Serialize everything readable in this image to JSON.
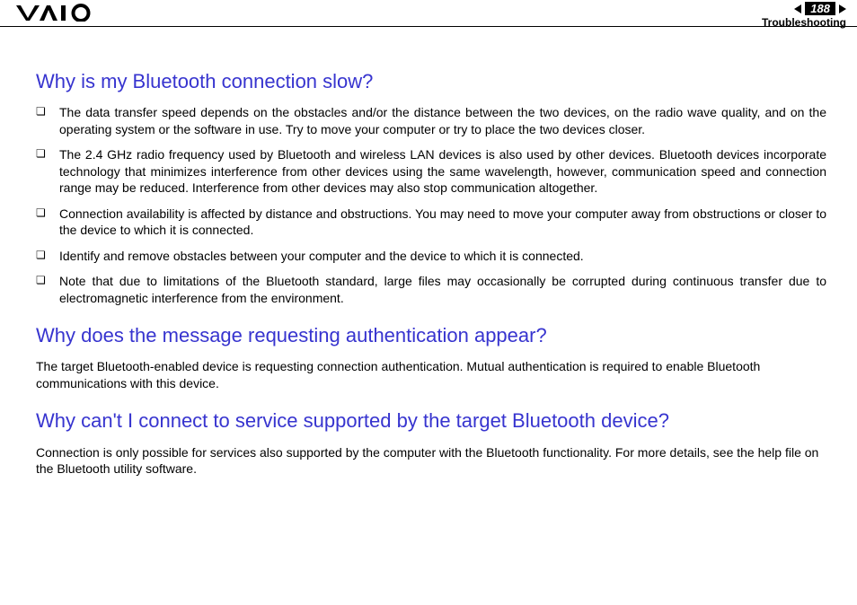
{
  "header": {
    "page_number": "188",
    "section": "Troubleshooting"
  },
  "sections": [
    {
      "heading": "Why is my Bluetooth connection slow?",
      "bullets": [
        "The data transfer speed depends on the obstacles and/or the distance between the two devices, on the radio wave quality, and on the operating system or the software in use. Try to move your computer or try to place the two devices closer.",
        "The 2.4 GHz radio frequency used by Bluetooth and wireless LAN devices is also used by other devices. Bluetooth devices incorporate technology that minimizes interference from other devices using the same wavelength, however, communication speed and connection range may be reduced. Interference from other devices may also stop communication altogether.",
        "Connection availability is affected by distance and obstructions. You may need to move your computer away from obstructions or closer to the device to which it is connected.",
        "Identify and remove obstacles between your computer and the device to which it is connected.",
        "Note that due to limitations of the Bluetooth standard, large files may occasionally be corrupted during continuous transfer due to electromagnetic interference from the environment."
      ]
    },
    {
      "heading": "Why does the message requesting authentication appear?",
      "body": "The target Bluetooth-enabled device is requesting connection authentication. Mutual authentication is required to enable Bluetooth communications with this device."
    },
    {
      "heading": "Why can't I connect to service supported by the target Bluetooth device?",
      "body": "Connection is only possible for services also supported by the computer with the Bluetooth functionality. For more details, see the help file on the Bluetooth utility software."
    }
  ]
}
